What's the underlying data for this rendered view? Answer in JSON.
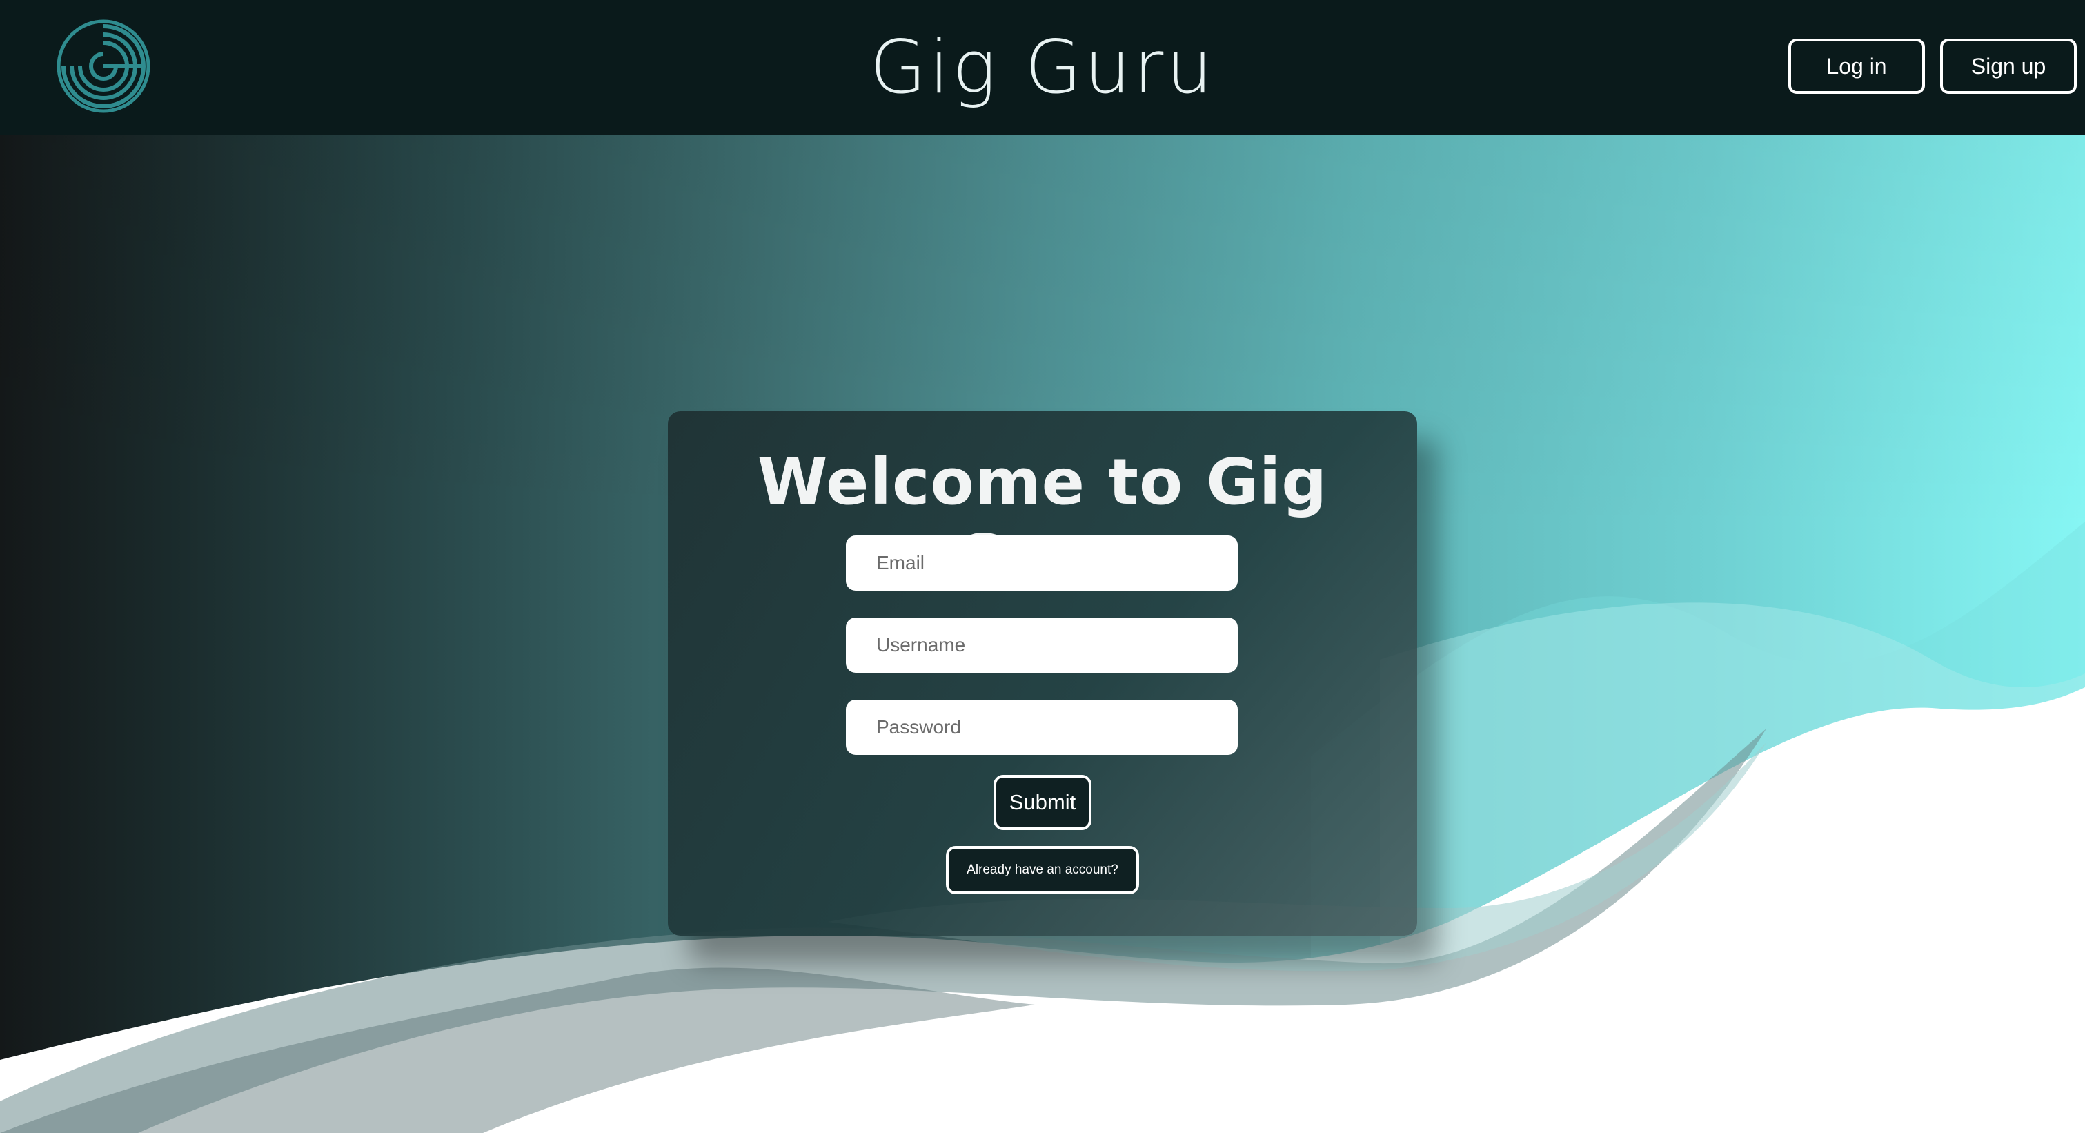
{
  "header": {
    "title": "Gig Guru",
    "logo_icon": "record-logo-icon",
    "login_label": "Log in",
    "signup_label": "Sign up"
  },
  "card": {
    "title": "Welcome to Gig Guru",
    "email_placeholder": "Email",
    "username_placeholder": "Username",
    "password_placeholder": "Password",
    "submit_label": "Submit",
    "account_link_label": "Already have an account?"
  },
  "colors": {
    "header_bg": "#0a1a1b",
    "accent_teal": "#86f6f4",
    "logo_teal": "#2f8c8f"
  }
}
